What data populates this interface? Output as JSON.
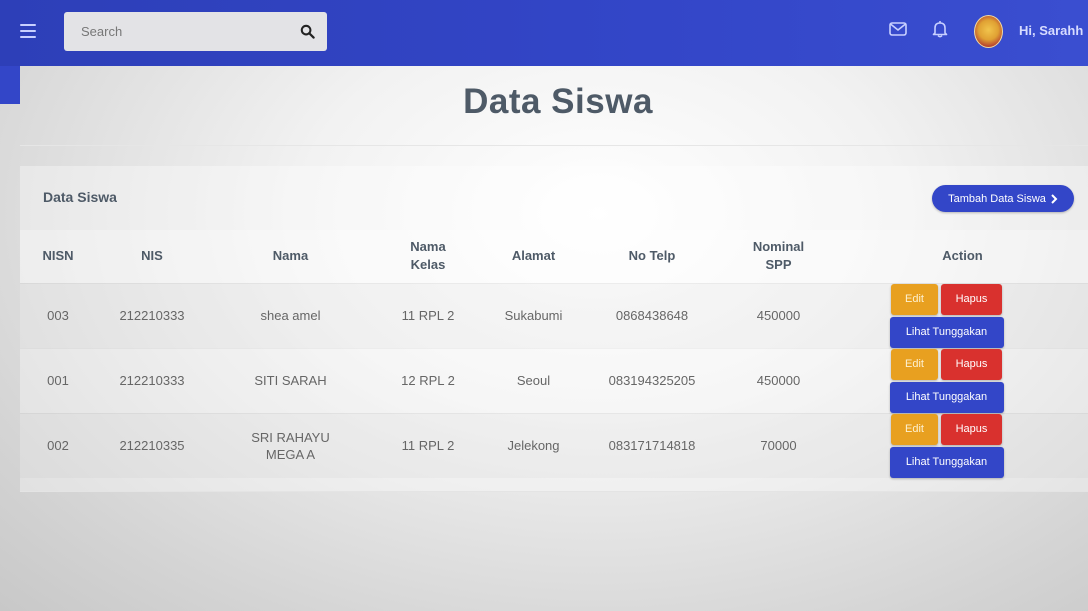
{
  "header": {
    "search_placeholder": "Search",
    "user_greeting": "Hi, Sarahh",
    "brand_color": "#3346c8"
  },
  "page": {
    "title": "Data Siswa"
  },
  "card": {
    "title": "Data Siswa",
    "add_button": "Tambah Data Siswa"
  },
  "table": {
    "headers": {
      "nisn": "NISN",
      "nis": "NIS",
      "nama": "Nama",
      "kelas": "Nama Kelas",
      "alamat": "Alamat",
      "telp": "No Telp",
      "spp": "Nominal SPP",
      "action": "Action"
    },
    "rows": [
      {
        "nisn": "003",
        "nis": "212210333",
        "nama": "shea amel",
        "kelas": "11 RPL 2",
        "alamat": "Sukabumi",
        "telp": "0868438648",
        "spp": "450000"
      },
      {
        "nisn": "001",
        "nis": "212210333",
        "nama": "SITI SARAH",
        "kelas": "12 RPL 2",
        "alamat": "Seoul",
        "telp": "083194325205",
        "spp": "450000"
      },
      {
        "nisn": "002",
        "nis": "212210335",
        "nama": "SRI RAHAYU MEGA A",
        "kelas": "11 RPL 2",
        "alamat": "Jelekong",
        "telp": "083171714818",
        "spp": "70000"
      }
    ],
    "actions": {
      "edit": "Edit",
      "hapus": "Hapus",
      "lihat": "Lihat Tunggakan"
    }
  }
}
